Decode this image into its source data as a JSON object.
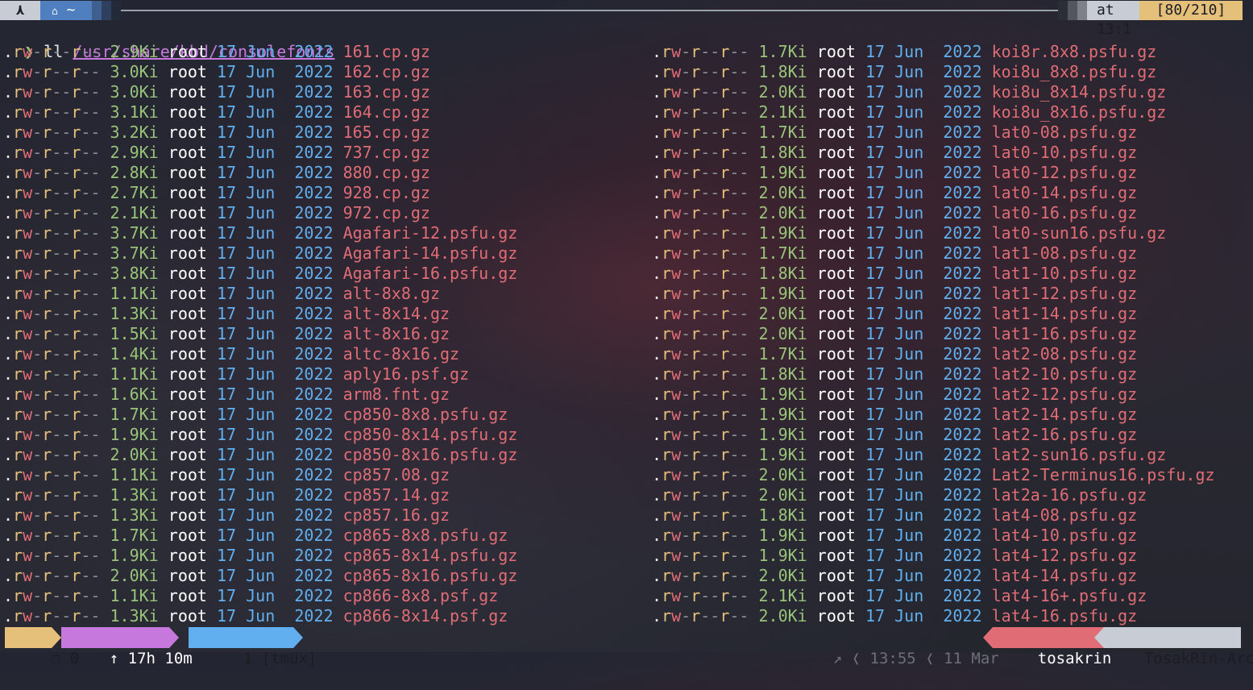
{
  "top_bar": {
    "home_segment_label": "~",
    "time_label": "at 13:1",
    "position_label": "[80/210]"
  },
  "prompt": {
    "symbol": "❯",
    "command": "ll",
    "path": "/usr/share/kbd/consolefonts"
  },
  "listing": {
    "owner": "root",
    "date_day": "17",
    "date_month": "Jun",
    "date_year": "2022",
    "left": [
      {
        "size": "2.9Ki",
        "name": "161.cp.gz"
      },
      {
        "size": "3.0Ki",
        "name": "162.cp.gz"
      },
      {
        "size": "3.0Ki",
        "name": "163.cp.gz"
      },
      {
        "size": "3.1Ki",
        "name": "164.cp.gz"
      },
      {
        "size": "3.2Ki",
        "name": "165.cp.gz"
      },
      {
        "size": "2.9Ki",
        "name": "737.cp.gz"
      },
      {
        "size": "2.8Ki",
        "name": "880.cp.gz"
      },
      {
        "size": "2.7Ki",
        "name": "928.cp.gz"
      },
      {
        "size": "2.1Ki",
        "name": "972.cp.gz"
      },
      {
        "size": "3.7Ki",
        "name": "Agafari-12.psfu.gz"
      },
      {
        "size": "3.7Ki",
        "name": "Agafari-14.psfu.gz"
      },
      {
        "size": "3.8Ki",
        "name": "Agafari-16.psfu.gz"
      },
      {
        "size": "1.1Ki",
        "name": "alt-8x8.gz"
      },
      {
        "size": "1.3Ki",
        "name": "alt-8x14.gz"
      },
      {
        "size": "1.5Ki",
        "name": "alt-8x16.gz"
      },
      {
        "size": "1.4Ki",
        "name": "altc-8x16.gz"
      },
      {
        "size": "1.1Ki",
        "name": "aply16.psf.gz"
      },
      {
        "size": "1.6Ki",
        "name": "arm8.fnt.gz"
      },
      {
        "size": "1.7Ki",
        "name": "cp850-8x8.psfu.gz"
      },
      {
        "size": "1.9Ki",
        "name": "cp850-8x14.psfu.gz"
      },
      {
        "size": "2.0Ki",
        "name": "cp850-8x16.psfu.gz"
      },
      {
        "size": "1.1Ki",
        "name": "cp857.08.gz"
      },
      {
        "size": "1.3Ki",
        "name": "cp857.14.gz"
      },
      {
        "size": "1.3Ki",
        "name": "cp857.16.gz"
      },
      {
        "size": "1.7Ki",
        "name": "cp865-8x8.psfu.gz"
      },
      {
        "size": "1.9Ki",
        "name": "cp865-8x14.psfu.gz"
      },
      {
        "size": "2.0Ki",
        "name": "cp865-8x16.psfu.gz"
      },
      {
        "size": "1.1Ki",
        "name": "cp866-8x8.psf.gz"
      },
      {
        "size": "1.3Ki",
        "name": "cp866-8x14.psf.gz"
      }
    ],
    "right": [
      {
        "size": "1.7Ki",
        "name": "koi8r.8x8.psfu.gz"
      },
      {
        "size": "1.8Ki",
        "name": "koi8u_8x8.psfu.gz"
      },
      {
        "size": "2.0Ki",
        "name": "koi8u_8x14.psfu.gz"
      },
      {
        "size": "2.1Ki",
        "name": "koi8u_8x16.psfu.gz"
      },
      {
        "size": "1.7Ki",
        "name": "lat0-08.psfu.gz"
      },
      {
        "size": "1.8Ki",
        "name": "lat0-10.psfu.gz"
      },
      {
        "size": "1.9Ki",
        "name": "lat0-12.psfu.gz"
      },
      {
        "size": "2.0Ki",
        "name": "lat0-14.psfu.gz"
      },
      {
        "size": "2.0Ki",
        "name": "lat0-16.psfu.gz"
      },
      {
        "size": "1.9Ki",
        "name": "lat0-sun16.psfu.gz"
      },
      {
        "size": "1.7Ki",
        "name": "lat1-08.psfu.gz"
      },
      {
        "size": "1.8Ki",
        "name": "lat1-10.psfu.gz"
      },
      {
        "size": "1.9Ki",
        "name": "lat1-12.psfu.gz"
      },
      {
        "size": "2.0Ki",
        "name": "lat1-14.psfu.gz"
      },
      {
        "size": "2.0Ki",
        "name": "lat1-16.psfu.gz"
      },
      {
        "size": "1.7Ki",
        "name": "lat2-08.psfu.gz"
      },
      {
        "size": "1.8Ki",
        "name": "lat2-10.psfu.gz"
      },
      {
        "size": "1.9Ki",
        "name": "lat2-12.psfu.gz"
      },
      {
        "size": "1.9Ki",
        "name": "lat2-14.psfu.gz"
      },
      {
        "size": "1.9Ki",
        "name": "lat2-16.psfu.gz"
      },
      {
        "size": "1.9Ki",
        "name": "lat2-sun16.psfu.gz"
      },
      {
        "size": "2.0Ki",
        "name": "Lat2-Terminus16.psfu.gz"
      },
      {
        "size": "2.0Ki",
        "name": "lat2a-16.psfu.gz"
      },
      {
        "size": "1.8Ki",
        "name": "lat4-08.psfu.gz"
      },
      {
        "size": "1.9Ki",
        "name": "lat4-10.psfu.gz"
      },
      {
        "size": "1.9Ki",
        "name": "lat4-12.psfu.gz"
      },
      {
        "size": "2.0Ki",
        "name": "lat4-14.psfu.gz"
      },
      {
        "size": "2.1Ki",
        "name": "lat4-16+.psfu.gz"
      },
      {
        "size": "2.0Ki",
        "name": "lat4-16.psfu.gz"
      }
    ]
  },
  "tmux_bar": {
    "session_label": "0",
    "uptime_label": "↑ 17h 10m",
    "window_label": "1 [tmux]",
    "time_label": "13:55",
    "date_label": "11 Mar",
    "user_label": "tosakrin",
    "host_label": "TosakRin-Arch"
  },
  "colors": {
    "read": "#e6c07b",
    "write": "#e06c75",
    "size": "#98c379",
    "date": "#61afef",
    "filename": "#e06c75",
    "seg_yellow": "#e5c07b",
    "seg_magenta": "#c678dd",
    "seg_blue": "#61afef",
    "seg_red": "#e06c75",
    "seg_gray": "#c8ccd4"
  }
}
